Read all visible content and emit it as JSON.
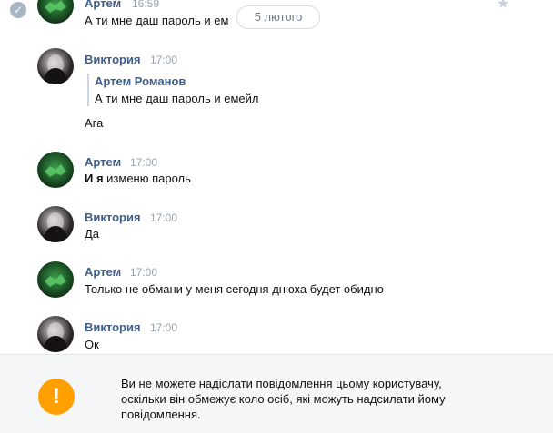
{
  "date_divider": "5 лютого",
  "messages": [
    {
      "author": "Артем",
      "time": "16:59",
      "text": "А ти мне даш пароль и ем"
    },
    {
      "author": "Виктория",
      "time": "17:00",
      "quote_author": "Артем Романов",
      "quote_text": "А ти мне даш пароль и емейл",
      "text": "Ага"
    },
    {
      "author": "Артем",
      "time": "17:00",
      "text_bold": "И я",
      "text": "изменю пароль"
    },
    {
      "author": "Виктория",
      "time": "17:00",
      "text": "Да"
    },
    {
      "author": "Артем",
      "time": "17:00",
      "text": "Только не обмани у меня сегодня днюха будет обидно"
    },
    {
      "author": "Виктория",
      "time": "17:00",
      "text": "Ок"
    }
  ],
  "footer": {
    "icon": "!",
    "line1": "Ви не можете надіслати повідомлення цьому користувачу,",
    "line2": "оскільки він обмежує коло осіб, які можуть надсилати йому",
    "line3": "повідомлення."
  },
  "colors": {
    "author": "#3f5f88",
    "time": "#9aa3ad",
    "warning": "#ffa000"
  },
  "icons": [
    "check-icon",
    "star-icon",
    "warning-icon"
  ]
}
